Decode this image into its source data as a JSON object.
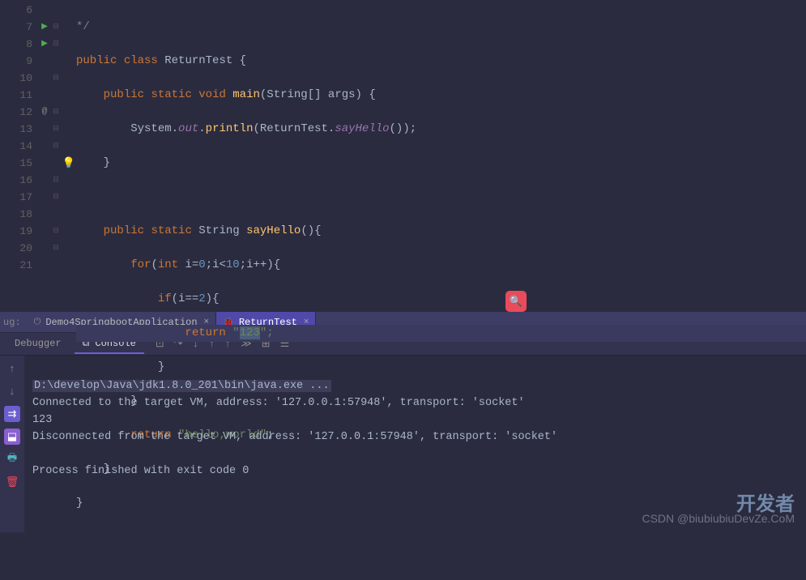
{
  "editor": {
    "lines": {
      "6": {
        "comment": "*/"
      },
      "7": {
        "kw1": "public",
        "kw2": "class",
        "cls": "ReturnTest"
      },
      "8": {
        "kw1": "public",
        "kw2": "static",
        "kw3": "void",
        "method": "main",
        "param_type": "String[]",
        "param_name": "args"
      },
      "9": {
        "cls": "System",
        "field": "out",
        "call": "println",
        "ref": "ReturnTest",
        "ref_method": "sayHello"
      },
      "10": {},
      "11": {},
      "12": {
        "kw1": "public",
        "kw2": "static",
        "ret": "String",
        "name": "sayHello"
      },
      "13": {
        "kw": "for",
        "typ": "int",
        "init": "i=",
        "n0": "0",
        "cond": ";i<",
        "n10": "10",
        "step": ";i++"
      },
      "14": {
        "kw": "if",
        "expr": "i==",
        "n": "2"
      },
      "15": {
        "kw": "return",
        "str": "\"",
        "val": "123",
        "end": "\";"
      },
      "16": {},
      "17": {},
      "18": {
        "kw": "return",
        "str": "\"hello,world\""
      },
      "19": {},
      "20": {}
    },
    "line_numbers": [
      "6",
      "7",
      "8",
      "9",
      "10",
      "11",
      "12",
      "13",
      "14",
      "15",
      "16",
      "17",
      "18",
      "19",
      "20",
      "21"
    ]
  },
  "tabs": {
    "ug": "ug:",
    "app": "Demo4SpringbootApplication",
    "run": "ReturnTest"
  },
  "toolbar": {
    "debugger": "Debugger",
    "console": "Console"
  },
  "console": {
    "cmd": "D:\\develop\\Java\\jdk1.8.0_201\\bin\\java.exe ...",
    "l1": "Connected to the target VM, address: '127.0.0.1:57948', transport: 'socket'",
    "l2": "123",
    "l3": "Disconnected from the target VM, address: '127.0.0.1:57948', transport: 'socket'",
    "l4": "",
    "l5": "Process finished with exit code 0"
  },
  "watermark": {
    "line1": "开发者",
    "line2": "CSDN @biubiubiuDevZe.CoM"
  }
}
